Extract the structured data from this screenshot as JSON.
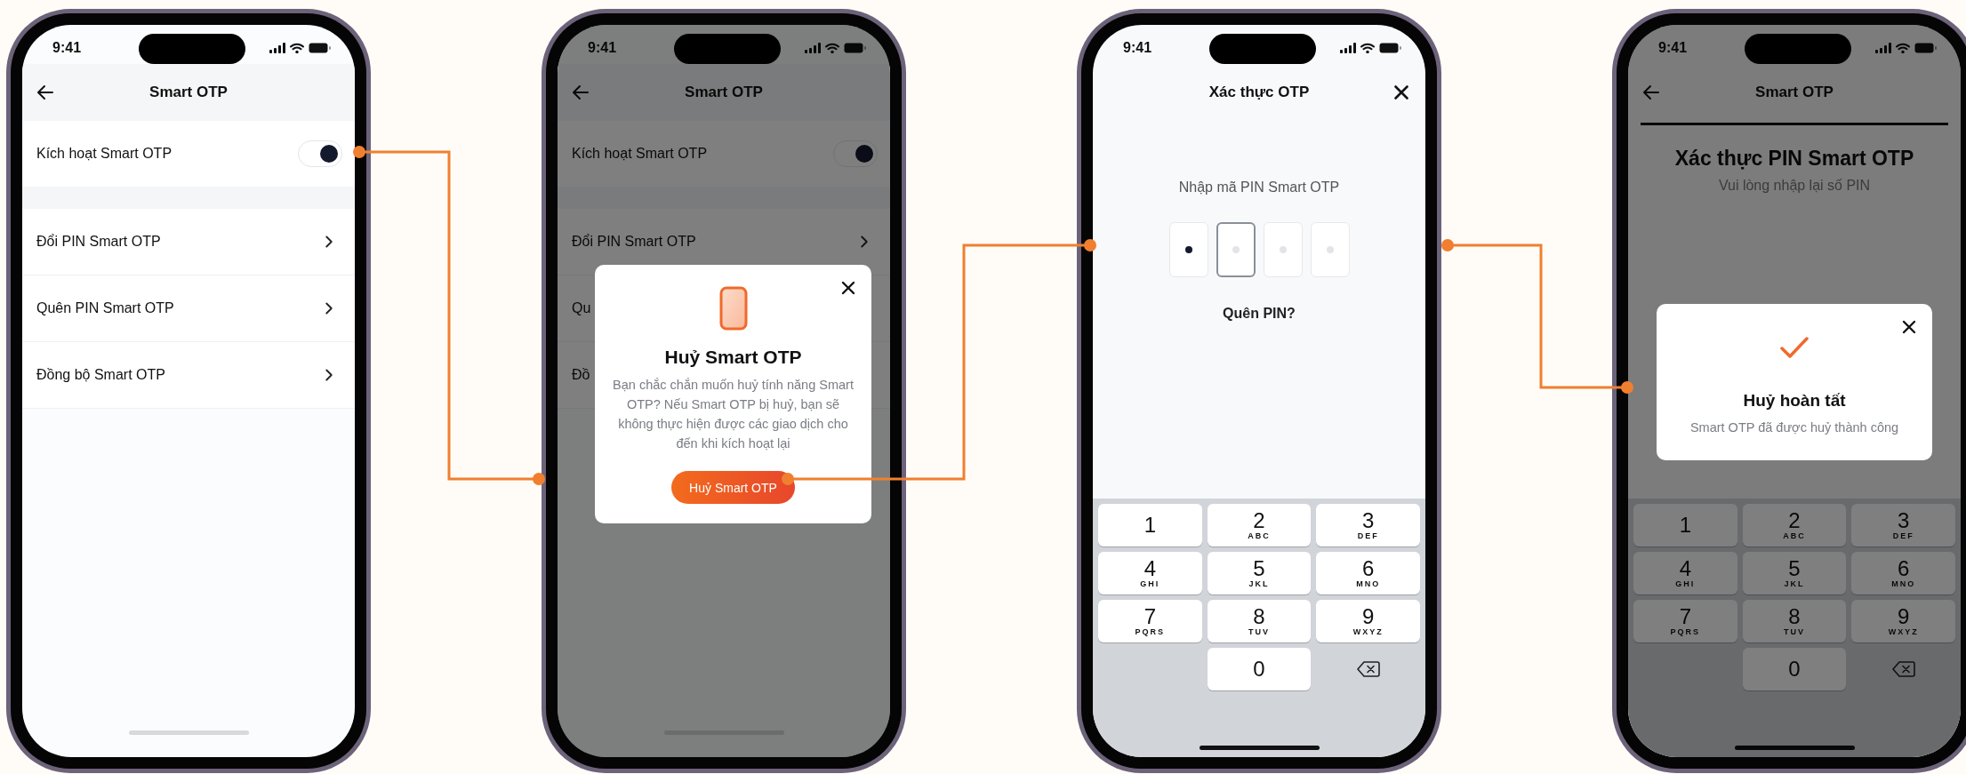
{
  "screens": [
    {
      "status_time": "9:41",
      "header": {
        "title": "Smart OTP",
        "kind": "back"
      },
      "dimmed": false,
      "toggle_row": {
        "label": "Kích hoạt Smart OTP",
        "on": true
      },
      "menu_items": [
        {
          "label": "Đổi PIN Smart OTP"
        },
        {
          "label": "Quên PIN Smart OTP"
        },
        {
          "label": "Đồng bộ Smart OTP"
        }
      ]
    },
    {
      "status_time": "9:41",
      "header": {
        "title": "Smart OTP",
        "kind": "back"
      },
      "dimmed": true,
      "toggle_row": {
        "label": "Kích hoạt Smart OTP",
        "on": true
      },
      "menu_items": [
        {
          "label": "Đổi PIN Smart OTP"
        },
        {
          "label": "Qu"
        },
        {
          "label": "Đồ"
        }
      ],
      "dialog": {
        "kind": "confirm",
        "title": "Huỷ Smart OTP",
        "message": "Bạn chắc chắn muốn huỷ tính năng Smart OTP? Nếu Smart OTP bị huỷ, bạn sẽ không thực hiện được các giao dịch cho đến khi kích hoạt lại",
        "button": "Huỷ Smart OTP"
      }
    },
    {
      "status_time": "9:41",
      "header": {
        "title": "Xác thực OTP",
        "kind": "close"
      },
      "dimmed": false,
      "prompt": "Nhập mã PIN Smart OTP",
      "pin_boxes": [
        {
          "filled": true,
          "focused": false
        },
        {
          "filled": false,
          "focused": true
        },
        {
          "filled": false,
          "focused": false
        },
        {
          "filled": false,
          "focused": false
        }
      ],
      "link": "Quên PIN?",
      "keypad": [
        {
          "kind": "digit",
          "digit": "1"
        },
        {
          "kind": "digit",
          "digit": "2",
          "letters": "ABC"
        },
        {
          "kind": "digit",
          "digit": "3",
          "letters": "DEF"
        },
        {
          "kind": "digit",
          "digit": "4",
          "letters": "GHI"
        },
        {
          "kind": "digit",
          "digit": "5",
          "letters": "JKL"
        },
        {
          "kind": "digit",
          "digit": "6",
          "letters": "MNO"
        },
        {
          "kind": "digit",
          "digit": "7",
          "letters": "PQRS"
        },
        {
          "kind": "digit",
          "digit": "8",
          "letters": "TUV"
        },
        {
          "kind": "digit",
          "digit": "9",
          "letters": "WXYZ"
        },
        {
          "kind": "blank"
        },
        {
          "kind": "digit",
          "digit": "0"
        },
        {
          "kind": "delete"
        }
      ]
    },
    {
      "status_time": "9:41",
      "header": {
        "title": "Smart OTP",
        "kind": "back"
      },
      "dimmed": true,
      "header_rule": true,
      "heading": "Xác thực PIN Smart OTP",
      "subheading": "Vui lòng nhập lại số PIN",
      "keypad": [
        {
          "kind": "digit",
          "digit": "1"
        },
        {
          "kind": "digit",
          "digit": "2",
          "letters": "ABC"
        },
        {
          "kind": "digit",
          "digit": "3",
          "letters": "DEF"
        },
        {
          "kind": "digit",
          "digit": "4",
          "letters": "GHI"
        },
        {
          "kind": "digit",
          "digit": "5",
          "letters": "JKL"
        },
        {
          "kind": "digit",
          "digit": "6",
          "letters": "MNO"
        },
        {
          "kind": "digit",
          "digit": "7",
          "letters": "PQRS"
        },
        {
          "kind": "digit",
          "digit": "8",
          "letters": "TUV"
        },
        {
          "kind": "digit",
          "digit": "9",
          "letters": "WXYZ"
        },
        {
          "kind": "blank"
        },
        {
          "kind": "digit",
          "digit": "0"
        },
        {
          "kind": "delete"
        }
      ],
      "dialog": {
        "kind": "success",
        "title": "Huỷ hoàn tất",
        "message": "Smart OTP đã được huỷ thành công"
      }
    }
  ]
}
